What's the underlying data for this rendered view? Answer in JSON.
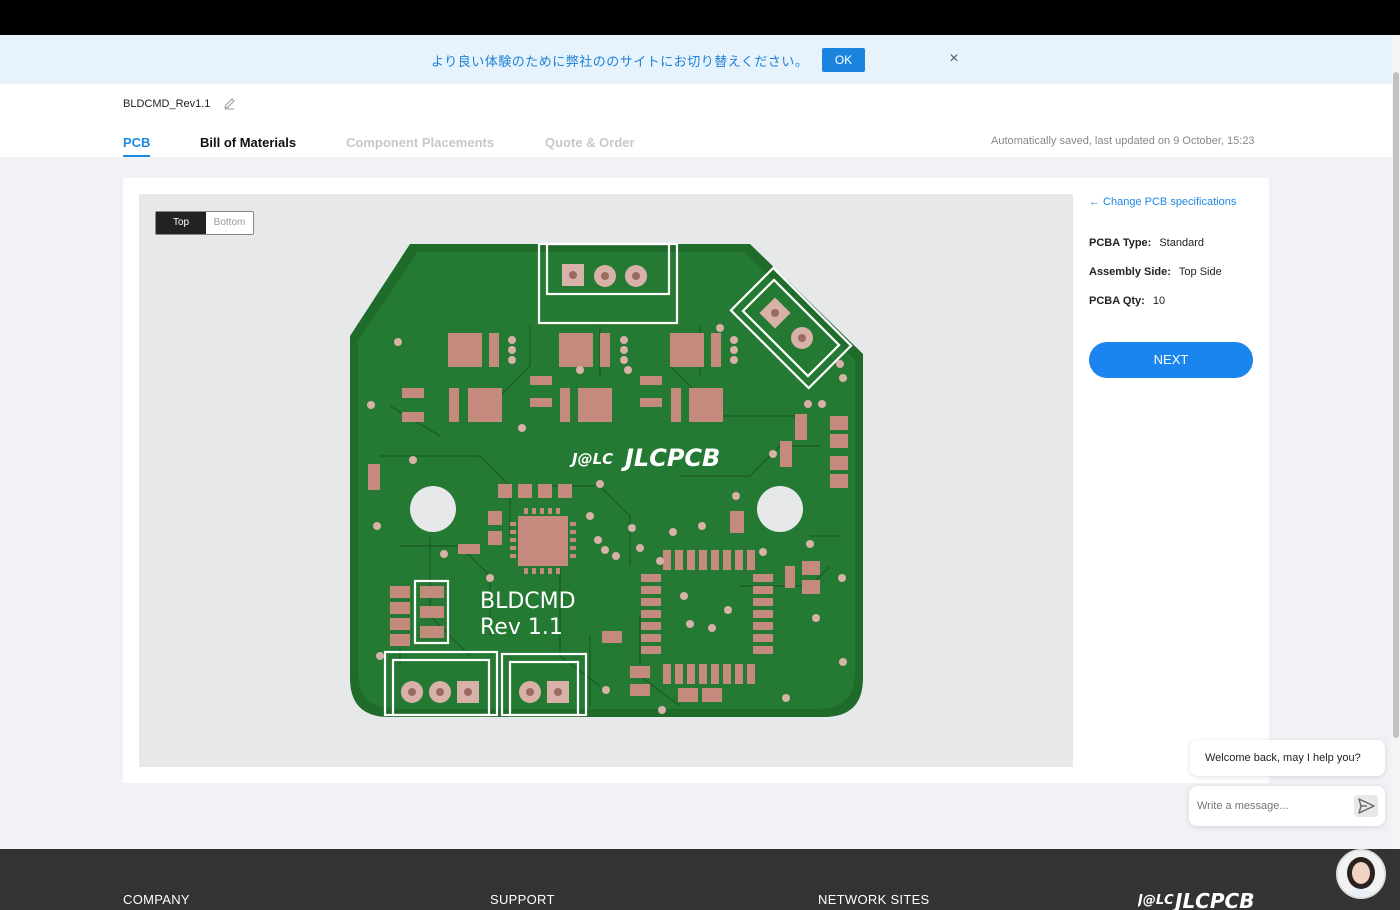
{
  "notice": {
    "text": "より良い体験のために弊社ののサイトにお切り替えください。",
    "ok_label": "OK",
    "close_label": "×"
  },
  "project": {
    "name": "BLDCMD_Rev1.1"
  },
  "tabs": [
    {
      "label": "PCB",
      "active": true
    },
    {
      "label": "Bill of Materials",
      "active": false
    },
    {
      "label": "Component Placements",
      "active": false
    },
    {
      "label": "Quote & Order",
      "active": false
    }
  ],
  "saved_text": "Automatically saved, last updated on 9 October, 15:23",
  "viewer": {
    "toggle_top": "Top",
    "toggle_bottom": "Bottom",
    "board_line1": "BLDCMD",
    "board_line2": "Rev 1.1",
    "board_logo_mark": "J@LC",
    "board_logo_text": "JLCPCB"
  },
  "specs": {
    "change_link": "← Change PCB specifications",
    "type_label": "PCBA Type:",
    "type_value": "Standard",
    "side_label": "Assembly Side:",
    "side_value": "Top Side",
    "qty_label": "PCBA Qty:",
    "qty_value": "10",
    "next_label": "NEXT"
  },
  "chat": {
    "welcome": "Welcome back, may I help you?",
    "placeholder": "Write a message..."
  },
  "footer": {
    "company": "COMPANY",
    "support": "SUPPORT",
    "network": "NETWORK SITES",
    "logo_mark": "J@LC",
    "logo_text": "JLCPCB"
  },
  "colors": {
    "accent": "#1e88e5",
    "board_green": "#1e6b2a",
    "pad_copper": "#c48a7e"
  }
}
